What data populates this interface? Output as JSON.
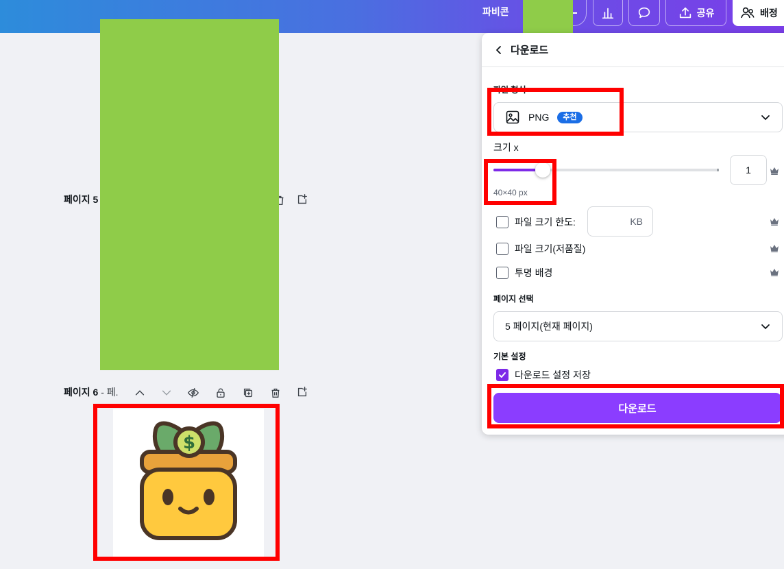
{
  "topbar": {
    "project_name": "파비콘",
    "share_label": "공유",
    "people_label": "배정"
  },
  "canvas": {
    "page5": {
      "label": "페이지 5"
    },
    "page6": {
      "label": "페이지 6",
      "sub": "- 페."
    }
  },
  "panel": {
    "title": "다운로드",
    "file_type": {
      "label": "파일 형식",
      "value": "PNG",
      "badge": "추천"
    },
    "size": {
      "label": "크기 x",
      "value": "1",
      "slider_fraction": 0.22,
      "px_text": "40×40 px"
    },
    "options": {
      "file_size_limit": {
        "label": "파일 크기 한도:",
        "unit": "KB",
        "checked": false
      },
      "low_quality": {
        "label": "파일 크기(저품질)",
        "checked": false
      },
      "transparent": {
        "label": "투명 배경",
        "checked": false
      }
    },
    "page_select": {
      "label": "페이지 선택",
      "value": "5 페이지(현재 페이지)"
    },
    "defaults": {
      "label": "기본 설정",
      "save_label": "다운로드 설정 저장",
      "checked": true
    },
    "download_button": "다운로드"
  },
  "colors": {
    "accent": "#7d2ae8",
    "button": "#8b3dff",
    "badge": "#1b6ee6",
    "highlight": "#ff0000",
    "placeholder_green": "#8fcc49"
  }
}
